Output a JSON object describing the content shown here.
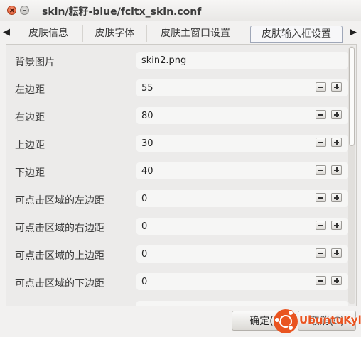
{
  "window": {
    "title": "skin/耘籽-blue/fcitx_skin.conf"
  },
  "tabs": [
    {
      "label": "皮肤信息"
    },
    {
      "label": "皮肤字体"
    },
    {
      "label": "皮肤主窗口设置"
    },
    {
      "label": "皮肤输入框设置",
      "active": true
    }
  ],
  "icons": {
    "tab_prev": "◀",
    "tab_next": "▶"
  },
  "rows": [
    {
      "label": "背景图片",
      "value": "skin2.png"
    },
    {
      "label": "左边距",
      "value": "55"
    },
    {
      "label": "右边距",
      "value": "80"
    },
    {
      "label": "上边距",
      "value": "30"
    },
    {
      "label": "下边距",
      "value": "40"
    },
    {
      "label": "可点击区域的左边距",
      "value": "0"
    },
    {
      "label": "可点击区域的右边距",
      "value": "0"
    },
    {
      "label": "可点击区域的上边距",
      "value": "0"
    },
    {
      "label": "可点击区域的下边距",
      "value": "0"
    }
  ],
  "buttons": {
    "ok": "确定(",
    "cancel": "取消(C)"
  },
  "watermark": {
    "text": "UbuntuKylin",
    "color": "#e95420"
  }
}
